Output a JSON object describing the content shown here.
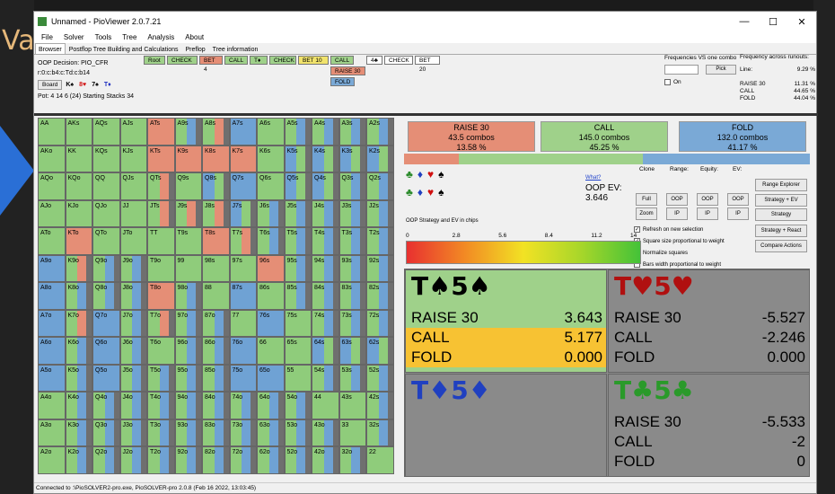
{
  "window": {
    "title": "Unnamed - PioViewer 2.0.7.21",
    "controls": [
      "—",
      "☐",
      "✕"
    ]
  },
  "background_text": "Va",
  "menu": [
    "File",
    "Solver",
    "Tools",
    "Tree",
    "Analysis",
    "About"
  ],
  "tabs": [
    "Browser",
    "Postflop Tree Building and Calculations",
    "Preflop",
    "Tree information"
  ],
  "info": {
    "decision": "OOP Decision:  PIO_CFR",
    "path": "r:0:c:b4:c:Td:c:b14",
    "board_button": "Board",
    "board_cards": [
      {
        "text": "K♠",
        "cls": "card-s"
      },
      {
        "text": "8♥",
        "cls": "card-h"
      },
      {
        "text": "7♠",
        "cls": "card-s"
      },
      {
        "text": "T♦",
        "cls": "card-blue"
      }
    ],
    "pot": "Pot: 4 14 6 (24) Starting Stacks 34"
  },
  "tree": {
    "row1": [
      {
        "label": "Root",
        "color": "green"
      },
      {
        "label": "CHECK",
        "color": "green"
      },
      {
        "label": "BET 4",
        "color": "red"
      },
      {
        "label": "CALL",
        "color": "green"
      },
      {
        "label": "T♦",
        "color": "green"
      },
      {
        "label": "CHECK",
        "color": "green"
      },
      {
        "label": "BET 10",
        "color": "yellow"
      },
      {
        "label": "CALL",
        "color": "green"
      },
      {
        "label": "4♣",
        "color": "white"
      },
      {
        "label": "CHECK",
        "color": "white"
      },
      {
        "label": "BET 20",
        "color": "white"
      }
    ],
    "raise_node": "RAISE 30",
    "fold_node": "FOLD"
  },
  "freq": {
    "title": "Frequencies VS one combo",
    "pick": "Pick",
    "on": "On",
    "runouts_title": "Frequency across runouts:",
    "line_label": "Line:",
    "line_value": "9.29 %",
    "rows": [
      {
        "k": "RAISE 30",
        "v": "11.31 %"
      },
      {
        "k": "CALL",
        "v": "44.65 %"
      },
      {
        "k": "FOLD",
        "v": "44.04 %"
      }
    ]
  },
  "matrix_labels": [
    [
      "AA",
      "AKs",
      "AQs",
      "AJs",
      "ATs",
      "A9s",
      "A8s",
      "A7s",
      "A6s",
      "A5s",
      "A4s",
      "A3s",
      "A2s"
    ],
    [
      "AKo",
      "KK",
      "KQs",
      "KJs",
      "KTs",
      "K9s",
      "K8s",
      "K7s",
      "K6s",
      "K5s",
      "K4s",
      "K3s",
      "K2s"
    ],
    [
      "AQo",
      "KQo",
      "QQ",
      "QJs",
      "QTs",
      "Q9s",
      "Q8s",
      "Q7s",
      "Q6s",
      "Q5s",
      "Q4s",
      "Q3s",
      "Q2s"
    ],
    [
      "AJo",
      "KJo",
      "QJo",
      "JJ",
      "JTs",
      "J9s",
      "J8s",
      "J7s",
      "J6s",
      "J5s",
      "J4s",
      "J3s",
      "J2s"
    ],
    [
      "ATo",
      "KTo",
      "QTo",
      "JTo",
      "TT",
      "T9s",
      "T8s",
      "T7s",
      "T6s",
      "T5s",
      "T4s",
      "T3s",
      "T2s"
    ],
    [
      "A9o",
      "K9o",
      "Q9o",
      "J9o",
      "T9o",
      "99",
      "98s",
      "97s",
      "96s",
      "95s",
      "94s",
      "93s",
      "92s"
    ],
    [
      "A8o",
      "K8o",
      "Q8o",
      "J8o",
      "T8o",
      "98o",
      "88",
      "87s",
      "86s",
      "85s",
      "84s",
      "83s",
      "82s"
    ],
    [
      "A7o",
      "K7o",
      "Q7o",
      "J7o",
      "T7o",
      "97o",
      "87o",
      "77",
      "76s",
      "75s",
      "74s",
      "73s",
      "72s"
    ],
    [
      "A6o",
      "K6o",
      "Q6o",
      "J6o",
      "T6o",
      "96o",
      "86o",
      "76o",
      "66",
      "65s",
      "64s",
      "63s",
      "62s"
    ],
    [
      "A5o",
      "K5o",
      "Q5o",
      "J5o",
      "T5o",
      "95o",
      "85o",
      "75o",
      "65o",
      "55",
      "54s",
      "53s",
      "52s"
    ],
    [
      "A4o",
      "K4o",
      "Q4o",
      "J4o",
      "T4o",
      "94o",
      "84o",
      "74o",
      "64o",
      "54o",
      "44",
      "43s",
      "42s"
    ],
    [
      "A3o",
      "K3o",
      "Q3o",
      "J3o",
      "T3o",
      "93o",
      "83o",
      "73o",
      "63o",
      "53o",
      "43o",
      "33",
      "32s"
    ],
    [
      "A2o",
      "K2o",
      "Q2o",
      "J2o",
      "T2o",
      "92o",
      "82o",
      "72o",
      "62o",
      "52o",
      "42o",
      "32o",
      "22"
    ]
  ],
  "matrix_colors": [
    [
      "g",
      "g",
      "g",
      "g",
      "r",
      "gb",
      "gr",
      "b",
      "g",
      "gb",
      "gb",
      "gb",
      "gb"
    ],
    [
      "g",
      "g",
      "g",
      "g",
      "r",
      "r",
      "r",
      "r",
      "g",
      "bg",
      "bg",
      "bg",
      "bg"
    ],
    [
      "g",
      "g",
      "g",
      "g",
      "gr",
      "g",
      "bg",
      "b",
      "g",
      "bg",
      "bg",
      "gb",
      "gb"
    ],
    [
      "g",
      "g",
      "g",
      "g",
      "gr",
      "gr",
      "gr",
      "bg",
      "gb",
      "gb",
      "gb",
      "gb",
      "gb"
    ],
    [
      "g",
      "r",
      "g",
      "g",
      "g",
      "g",
      "r",
      "gr",
      "gb",
      "gb",
      "gb",
      "gb",
      "gb"
    ],
    [
      "b",
      "gr",
      "gb",
      "gb",
      "g",
      "g",
      "g",
      "g",
      "r",
      "gb",
      "gb",
      "gb",
      "gb"
    ],
    [
      "b",
      "gb",
      "gb",
      "gb",
      "r",
      "gb",
      "g",
      "b",
      "g",
      "gb",
      "gb",
      "gb",
      "gb"
    ],
    [
      "b",
      "gr",
      "b",
      "gb",
      "gr",
      "gb",
      "gb",
      "g",
      "b",
      "g",
      "gb",
      "gb",
      "gb"
    ],
    [
      "b",
      "gb",
      "b",
      "gb",
      "g",
      "gb",
      "gb",
      "b",
      "g",
      "g",
      "bg",
      "bg",
      "bg"
    ],
    [
      "b",
      "gb",
      "b",
      "gb",
      "gb",
      "gb",
      "gb",
      "b",
      "b",
      "g",
      "gb",
      "gb",
      "gb"
    ],
    [
      "g",
      "gb",
      "gb",
      "gb",
      "gb",
      "gb",
      "gb",
      "gb",
      "gb",
      "gb",
      "g",
      "g",
      "gb"
    ],
    [
      "g",
      "gb",
      "gb",
      "gb",
      "gb",
      "gb",
      "gb",
      "gb",
      "gb",
      "gb",
      "gb",
      "g",
      "gb"
    ],
    [
      "g",
      "gb",
      "gb",
      "gb",
      "gb",
      "gb",
      "gb",
      "gb",
      "gb",
      "gb",
      "gb",
      "gb",
      "g"
    ]
  ],
  "strategy": [
    {
      "name": "RAISE 30",
      "combos": "43.5 combos",
      "pct": "13.58 %",
      "color": "#e58e76",
      "fraction": 0.1358
    },
    {
      "name": "CALL",
      "combos": "145.0 combos",
      "pct": "45.25 %",
      "color": "#9fd18a",
      "fraction": 0.4525
    },
    {
      "name": "FOLD",
      "combos": "132.0 combos",
      "pct": "41.17 %",
      "color": "#7aa9d6",
      "fraction": 0.4117
    }
  ],
  "suits": {
    "row1": [
      {
        "t": "♣",
        "c": "#2a8a2a"
      },
      {
        "t": "♦",
        "c": "#2040c0"
      },
      {
        "t": "♥",
        "c": "#d01010"
      },
      {
        "t": "♠",
        "c": "#000"
      }
    ],
    "row2": [
      {
        "t": "♣",
        "c": "#2a8a2a"
      },
      {
        "t": "♦",
        "c": "#2040c0"
      },
      {
        "t": "♥",
        "c": "#d01010"
      },
      {
        "t": "♠",
        "c": "#000"
      }
    ]
  },
  "ev": {
    "what": "What?",
    "label": "OOP EV:",
    "value": "3.646"
  },
  "controls": {
    "clone": "Clone",
    "range": "Range:",
    "equity": "Equity:",
    "ev": "EV:",
    "full": "Full",
    "zoom": "Zoom",
    "oop": "OOP",
    "ip": "IP",
    "range_explorer": "Range Explorer",
    "strategy_ev": "Strategy + EV",
    "strategy": "Strategy",
    "strategy_react": "Strategy + React",
    "compare": "Compare Actions",
    "checks": [
      {
        "label": "Refresh on new selection",
        "checked": true
      },
      {
        "label": "Square size proportional to weight",
        "checked": true
      },
      {
        "label": "Normalize squares",
        "checked": true
      },
      {
        "label": "Bars width proportional to weight",
        "checked": false
      }
    ]
  },
  "gradient": {
    "label": "OOP Strategy and EV in chips",
    "ticks": [
      "0",
      "2.8",
      "5.6",
      "8.4",
      "11.2",
      "14"
    ]
  },
  "quadrants": [
    {
      "head": "T♠5♠",
      "headColor": "#000",
      "bg": "#9fd18a",
      "rows": [
        {
          "k": "RAISE 30",
          "v": "3.643",
          "bg": "#9fd18a"
        },
        {
          "k": "CALL",
          "v": "5.177",
          "bg": "#f7c233"
        },
        {
          "k": "FOLD",
          "v": "0.000",
          "bg": "#f7c233"
        }
      ]
    },
    {
      "head": "T♥5♥",
      "headColor": "#b01010",
      "bg": "#8a8a8a",
      "rows": [
        {
          "k": "RAISE 30",
          "v": "-5.527",
          "bg": "#8a8a8a"
        },
        {
          "k": "CALL",
          "v": "-2.246",
          "bg": "#8a8a8a"
        },
        {
          "k": "FOLD",
          "v": "0.000",
          "bg": "#8a8a8a"
        }
      ]
    },
    {
      "head": "T♦5♦",
      "headColor": "#2040c0",
      "bg": "#8a8a8a",
      "rows": []
    },
    {
      "head": "T♣5♣",
      "headColor": "#2a9a2a",
      "bg": "#8a8a8a",
      "rows": [
        {
          "k": "RAISE 30",
          "v": "-5.533",
          "bg": "#8a8a8a"
        },
        {
          "k": "CALL",
          "v": "-2",
          "bg": "#8a8a8a"
        },
        {
          "k": "FOLD",
          "v": "0",
          "bg": "#8a8a8a"
        }
      ]
    }
  ],
  "status": "Connected to :\\PioSOLVER2-pro.exe, PioSOLVER-pro 2.0.8 (Feb 16 2022, 13:03:45)"
}
